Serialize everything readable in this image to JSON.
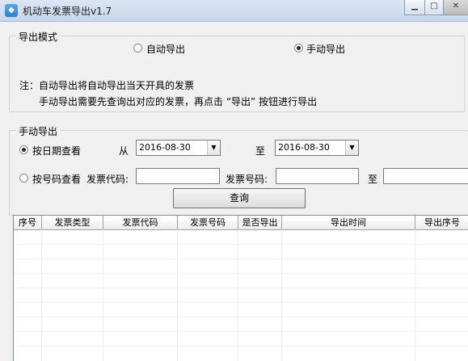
{
  "window": {
    "title": "机动车发票导出v1.7"
  },
  "mode_group": {
    "legend": "导出模式",
    "auto_label": "自动导出",
    "manual_label": "手动导出",
    "selected": "manual",
    "note_line1": "注：自动导出将自动导出当天开具的发票",
    "note_line2": "手动导出需要先查询出对应的发票，再点击 “导出” 按钮进行导出"
  },
  "manual_group": {
    "legend": "手动导出",
    "by_date_label": "按日期查看",
    "by_number_label": "按号码查看",
    "selected": "by_date",
    "from_label": "从",
    "to_label": "至",
    "date_from": "2016-08-30",
    "date_to": "2016-08-30",
    "invoice_code_label": "发票代码:",
    "invoice_code_value": "",
    "invoice_number_label": "发票号码:",
    "invoice_number_from": "",
    "range_to_label": "至",
    "invoice_number_to": "",
    "query_button": "查询"
  },
  "table": {
    "columns": [
      "序号",
      "发票类型",
      "发票代码",
      "发票号码",
      "是否导出",
      "导出时间",
      "导出序号"
    ],
    "rows": []
  }
}
